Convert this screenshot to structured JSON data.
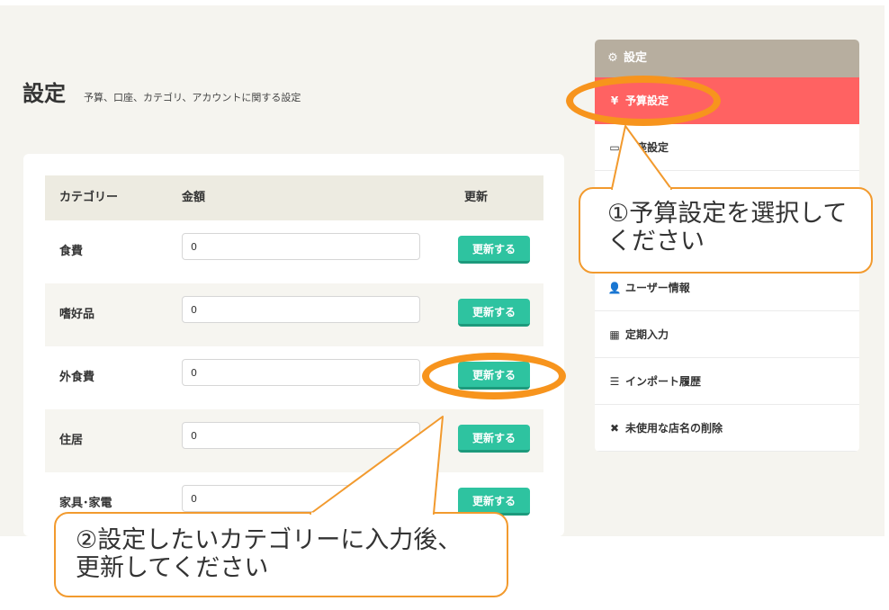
{
  "header": {
    "title": "設定",
    "subtitle": "予算、口座、カテゴリ、アカウントに関する設定"
  },
  "table": {
    "columns": [
      "カテゴリー",
      "金額",
      "更新"
    ],
    "rows": [
      {
        "category": "食費",
        "amount": "0",
        "button": "更新する"
      },
      {
        "category": "嗜好品",
        "amount": "0",
        "button": "更新する"
      },
      {
        "category": "外食費",
        "amount": "0",
        "button": "更新する"
      },
      {
        "category": "住居",
        "amount": "0",
        "button": "更新する"
      },
      {
        "category": "家具･家電",
        "amount": "0",
        "button": "更新する"
      }
    ]
  },
  "sidebar": {
    "header": "設定",
    "header_icon": "gear-icon",
    "items": [
      {
        "label": "予算設定",
        "icon": "yen-icon",
        "glyph": "¥",
        "active": true
      },
      {
        "label": "口座設定",
        "icon": "credit-card-icon",
        "glyph": "▭",
        "active": false
      },
      {
        "label": "ユーザー情報",
        "icon": "user-icon",
        "glyph": "👤",
        "active": false
      },
      {
        "label": "定期入力",
        "icon": "calendar-icon",
        "glyph": "▦",
        "active": false
      },
      {
        "label": "インポート履歴",
        "icon": "list-icon",
        "glyph": "☰",
        "active": false
      },
      {
        "label": "未使用な店名の削除",
        "icon": "close-icon",
        "glyph": "✖",
        "active": false
      }
    ]
  },
  "callouts": {
    "step1": [
      "①予算設定を選択して",
      "ください"
    ],
    "step2": [
      "②設定したいカテゴリーに入力後、",
      "更新してください"
    ]
  },
  "colors": {
    "accent_active": "#ff6262",
    "button": "#2ec3a0",
    "sidebar_header": "#b7ae9f",
    "annotation": "#f7941d"
  }
}
